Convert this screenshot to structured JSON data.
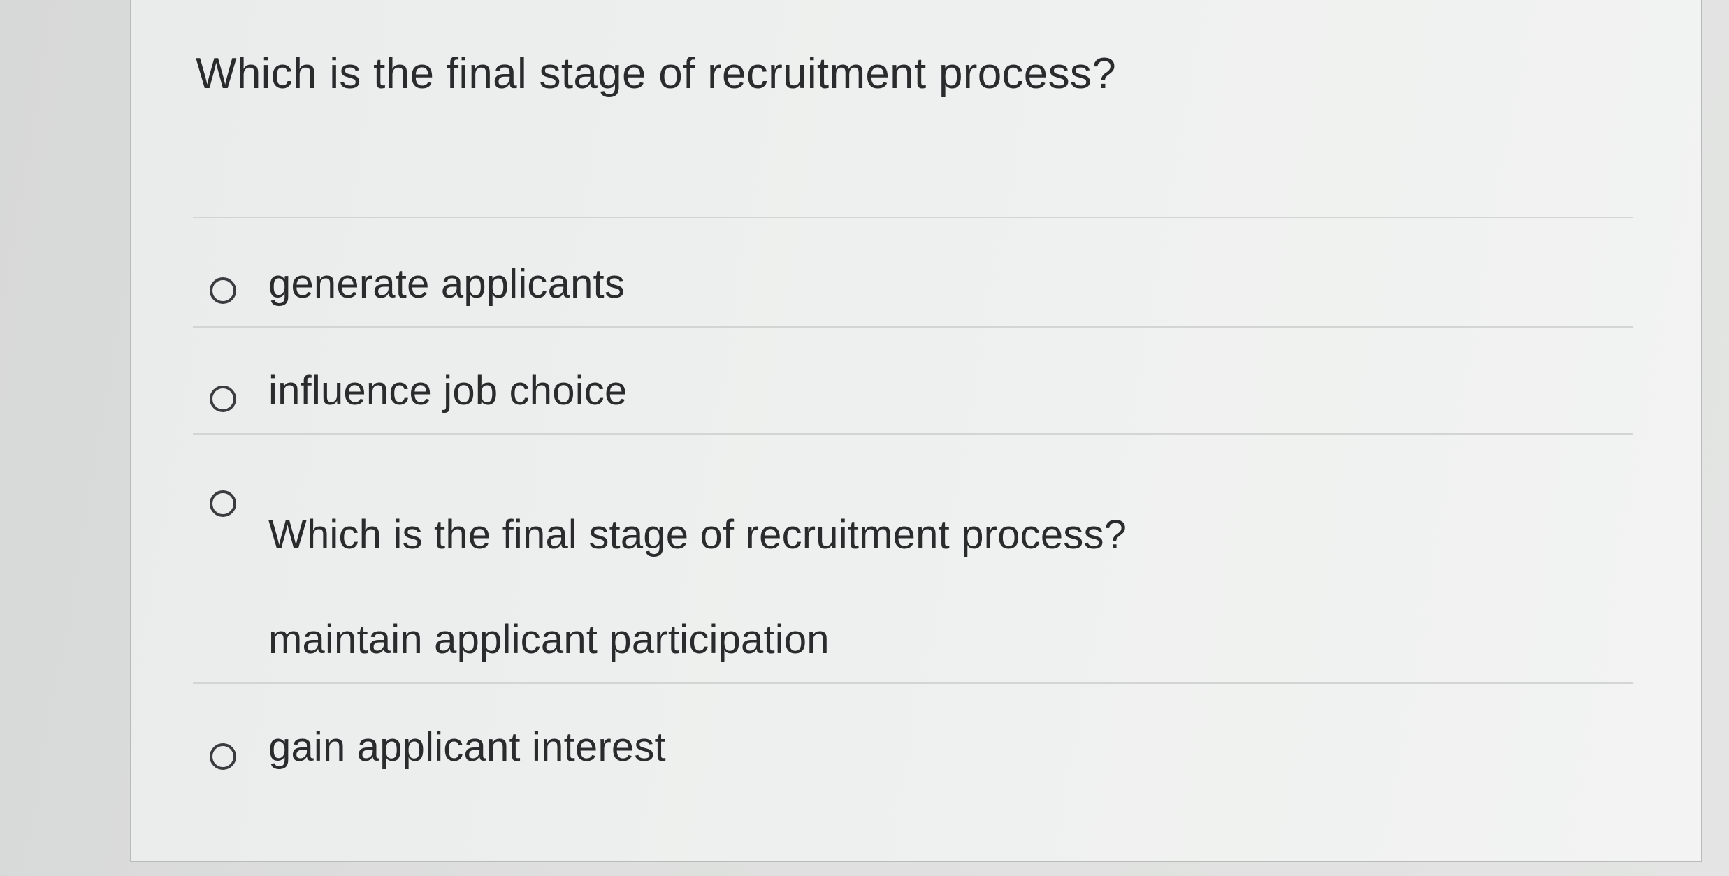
{
  "question": {
    "text": "Which is the final stage of recruitment process?"
  },
  "options": [
    {
      "lines": [
        "generate applicants"
      ]
    },
    {
      "lines": [
        "influence job choice"
      ]
    },
    {
      "lines": [
        "Which is the final stage of recruitment process?",
        "maintain applicant participation"
      ]
    },
    {
      "lines": [
        "gain applicant interest"
      ]
    }
  ]
}
